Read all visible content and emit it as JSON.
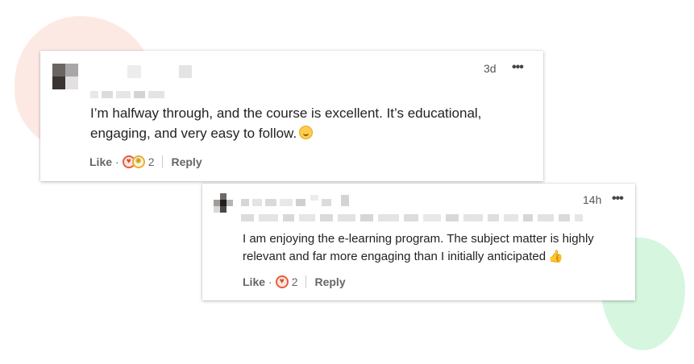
{
  "comments": [
    {
      "time": "3d",
      "text": "I’m halfway through, and the course is excellent. It’s educational, engaging, and very easy to follow.",
      "like_label": "Like",
      "separator": "·",
      "reaction_count": "2",
      "reply_label": "Reply",
      "reactions": [
        "heart-icon",
        "lightbulb-icon"
      ],
      "emoji": "smile-emoji-icon"
    },
    {
      "time": "14h",
      "text_line1": "I am enjoying the e-learning program. The subject matter is highly",
      "text_line2": "relevant and far more engaging than I initially anticipated",
      "like_label": "Like",
      "separator": "·",
      "reaction_count": "2",
      "reply_label": "Reply",
      "reactions": [
        "heart-icon"
      ],
      "emoji": "thumbs-up-emoji-icon"
    }
  ],
  "more_icon": "•••",
  "colors": {
    "pink_blob": "#fde9e4",
    "green_blob": "#d6f6e0",
    "love": "#e85c3c"
  }
}
